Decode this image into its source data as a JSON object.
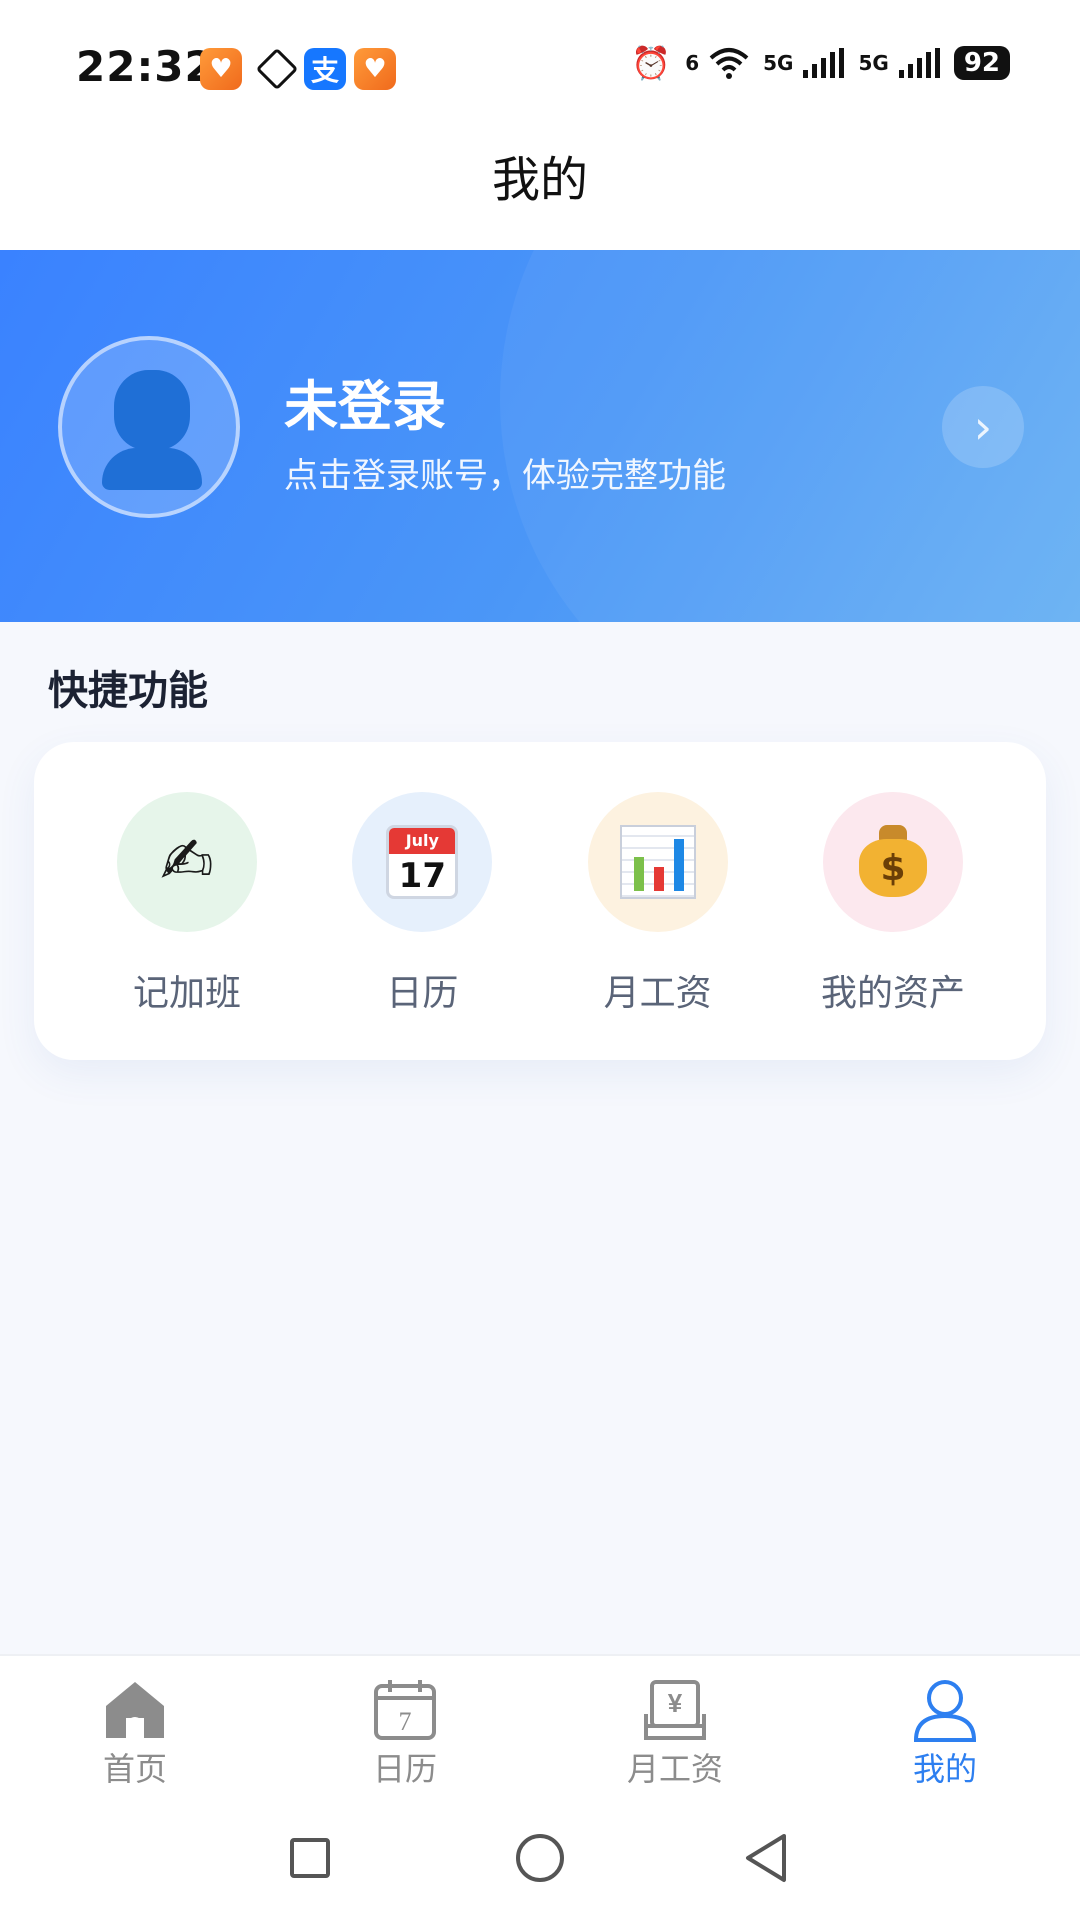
{
  "status_bar": {
    "time": "22:32",
    "battery": "92",
    "network_1": "5G",
    "network_2": "5G",
    "wifi_badge": "6",
    "alipay_glyph": "支"
  },
  "header": {
    "title": "我的"
  },
  "profile": {
    "name": "未登录",
    "subtitle": "点击登录账号，体验完整功能",
    "chevron": "›"
  },
  "quick": {
    "title": "快捷功能",
    "items": [
      {
        "label": "记加班",
        "icon": "writing-hand-icon",
        "bg": "#e6f5ea"
      },
      {
        "label": "日历",
        "icon": "calendar-icon",
        "bg": "#e6f0fc",
        "calendar_month": "July",
        "calendar_day": "17"
      },
      {
        "label": "月工资",
        "icon": "bar-chart-icon",
        "bg": "#fdf2e0"
      },
      {
        "label": "我的资产",
        "icon": "money-bag-icon",
        "bg": "#fce8ee",
        "bag_symbol": "$"
      }
    ]
  },
  "nav": {
    "items": [
      {
        "label": "首页",
        "icon": "home-icon",
        "active": false
      },
      {
        "label": "日历",
        "icon": "calendar-icon",
        "active": false,
        "day": "7"
      },
      {
        "label": "月工资",
        "icon": "salary-icon",
        "active": false,
        "symbol": "¥"
      },
      {
        "label": "我的",
        "icon": "person-icon",
        "active": true
      }
    ]
  },
  "colors": {
    "accent": "#2d7ff0",
    "banner_start": "#3a82ff",
    "banner_end": "#67b0f3"
  }
}
